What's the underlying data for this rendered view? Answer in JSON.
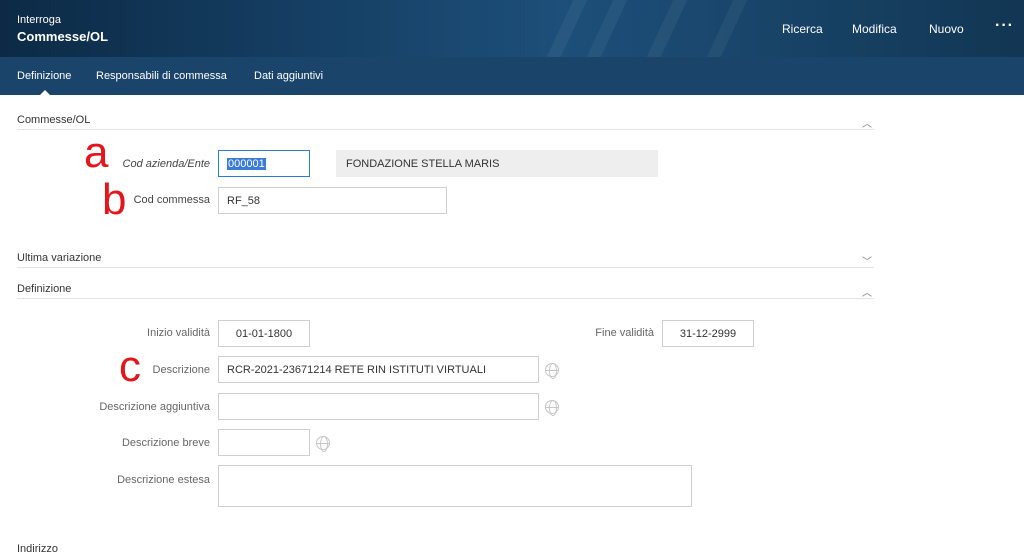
{
  "header": {
    "subtitle": "Interroga",
    "title": "Commesse/OL",
    "actions": {
      "search": "Ricerca",
      "edit": "Modifica",
      "new": "Nuovo",
      "more": "···"
    }
  },
  "tabs": [
    "Definizione",
    "Responsabili di commessa",
    "Dati aggiuntivi"
  ],
  "sections": {
    "commesse": "Commesse/OL",
    "ultima": "Ultima variazione",
    "definizione": "Definizione",
    "indirizzo": "Indirizzo"
  },
  "form": {
    "cod_azienda_label": "Cod azienda/Ente",
    "cod_azienda_value": "000001",
    "azienda_name": "FONDAZIONE STELLA MARIS",
    "cod_commessa_label": "Cod commessa",
    "cod_commessa_value": "RF_58",
    "inizio_label": "Inizio validità",
    "inizio_value": "01-01-1800",
    "fine_label": "Fine validità",
    "fine_value": "31-12-2999",
    "descrizione_label": "Descrizione",
    "descrizione_value": "RCR-2021-23671214 RETE RIN ISTITUTI VIRTUALI",
    "descr_agg_label": "Descrizione aggiuntiva",
    "descr_agg_value": "",
    "descr_breve_label": "Descrizione breve",
    "descr_breve_value": "",
    "descr_estesa_label": "Descrizione estesa",
    "descr_estesa_value": ""
  },
  "annotations": {
    "a": "a",
    "b": "b",
    "c": "c"
  },
  "icons": {
    "chevron_up": "chevron-up-icon",
    "chevron_down": "chevron-down-icon",
    "globe": "globe-icon"
  },
  "colors": {
    "header": "#153f63",
    "tabbar": "#1a4469",
    "annotation": "#e3161c",
    "selection": "#3a7bd5"
  }
}
